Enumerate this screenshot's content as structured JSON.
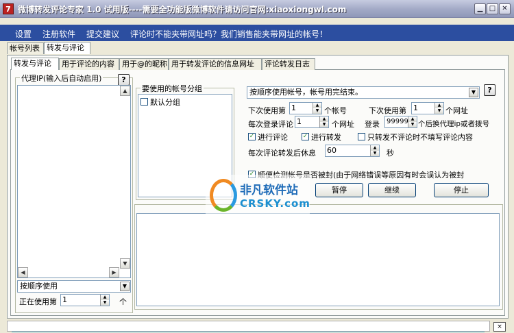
{
  "window": {
    "title": "微博转发评论专家  1.0  试用版----需要全功能版微博软件请访问官网:xiaoxiongwl.com",
    "icon_glyph": "7",
    "min_glyph": "▁",
    "max_glyph": "□",
    "close_glyph": "✕"
  },
  "menu": {
    "items": [
      "设置",
      "注册软件",
      "提交建议"
    ],
    "notice": "评论时不能夹带网址吗？我们销售能夹带网址的帐号！"
  },
  "tabs_main": [
    "帐号列表",
    "转发与评论"
  ],
  "tabs_sub": [
    "转发与评论",
    "用于评论的内容",
    "用于@的昵称",
    "用于转发评论的信息网址",
    "评论转发日志"
  ],
  "proxy": {
    "label": "代理IP(输入后自动启用)",
    "help": "?",
    "order_select": "按顺序使用",
    "using_label": "正在使用第",
    "using_value": "1",
    "using_unit": "个"
  },
  "account_group": {
    "label": "要使用的帐号分组",
    "items": [
      {
        "label": "默认分组",
        "checked": false
      }
    ]
  },
  "settings": {
    "mode_select": "按顺序使用帐号，帐号用完结束。",
    "help": "?",
    "next_account_label": "下次使用第",
    "next_account_value": "1",
    "next_account_unit": "个帐号",
    "next_url_label": "下次使用第",
    "next_url_value": "1",
    "next_url_unit": "个网址",
    "per_login_label": "每次登录评论",
    "per_login_value": "1",
    "per_login_unit": "个网址",
    "login_label": "登录",
    "login_value": "999999",
    "login_unit": "个后换代理ip或者拨号",
    "cb_comment": "进行评论",
    "cb_forward": "进行转发",
    "cb_no_content": "只转发不评论时不填写评论内容",
    "rest_label": "每次评论转发后休息",
    "rest_value": "60",
    "rest_unit": "秒",
    "cb_detect": "顺便检测帐号是否被封(由于网络错误等原因有时会误认为被封",
    "btn_pause": "暂停",
    "btn_continue": "继续",
    "btn_stop": "停止"
  },
  "watermark": {
    "cn": "非凡软件站",
    "en": "CRSKY.com"
  },
  "status": {
    "close_glyph": "×"
  }
}
